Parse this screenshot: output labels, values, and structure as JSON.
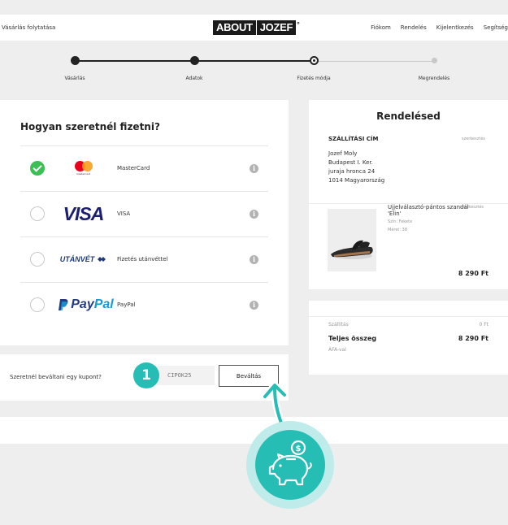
{
  "header": {
    "back_link": "Vásárlás folytatása",
    "logo_left": "ABOUT",
    "logo_right": "JOZEF",
    "logo_mark": "°",
    "nav": [
      "Fiókom",
      "Rendelés",
      "Kijelentkezés",
      "Segítség"
    ]
  },
  "steps": [
    {
      "label": "Vásárlás",
      "state": "done"
    },
    {
      "label": "Adatok",
      "state": "done"
    },
    {
      "label": "Fizetés módja",
      "state": "current"
    },
    {
      "label": "Megrendelés",
      "state": "todo"
    }
  ],
  "payment": {
    "title": "Hogyan szeretnél fizetni?",
    "options": [
      {
        "brand": "mastercard",
        "brand_text": "mastercard",
        "name": "MasterCard",
        "selected": true
      },
      {
        "brand": "visa",
        "brand_text": "VISA",
        "name": "VISA",
        "selected": false
      },
      {
        "brand": "utanvet",
        "brand_text": "UTÁNVÉT",
        "name": "Fizetés utánvéttel",
        "selected": false
      },
      {
        "brand": "paypal",
        "brand_text_1": "Pay",
        "brand_text_2": "Pal",
        "name": "PayPal",
        "selected": false
      }
    ],
    "info_glyph": "i"
  },
  "coupon": {
    "label": "Szeretnél beváltani egy kupont?",
    "value": "CIPOK25",
    "button": "Beváltás",
    "step_badge": "1"
  },
  "order": {
    "title": "Rendelésed",
    "shipping_title": "SZÁLLÍTÁSI CÍM",
    "edit": "szerkesztés",
    "address": [
      "Jozef Moly",
      "Budapest I. Ker.",
      "juraja hronca 24",
      "1014 Magyarország"
    ],
    "product": {
      "name_line1": "Ujjelválasztó-pántos szandál",
      "name_line2": "'Elin'",
      "edit": "szerkesztés",
      "color": "Szín: Fekete",
      "size": "Méret: 38",
      "price": "8 290 Ft"
    }
  },
  "totals": {
    "shipping_label": "Szállítás",
    "shipping_value": "0 Ft",
    "total_label": "Teljes összeg",
    "total_value": "8 290 Ft",
    "vat_note": "ÁFA-val"
  },
  "colors": {
    "accent": "#26bdb5",
    "accent_light": "#bfecea",
    "selected_green": "#3cbf54",
    "mastercard_red": "#eb001b",
    "mastercard_orange": "#f79e1b",
    "visa_blue": "#1a1f71",
    "paypal_dark": "#253b80",
    "paypal_light": "#179bd7"
  },
  "icons": {
    "check": "check-icon",
    "info": "info-icon",
    "pointer_arrow": "arrow-up-icon",
    "piggy": "piggy-bank-coin-icon"
  }
}
